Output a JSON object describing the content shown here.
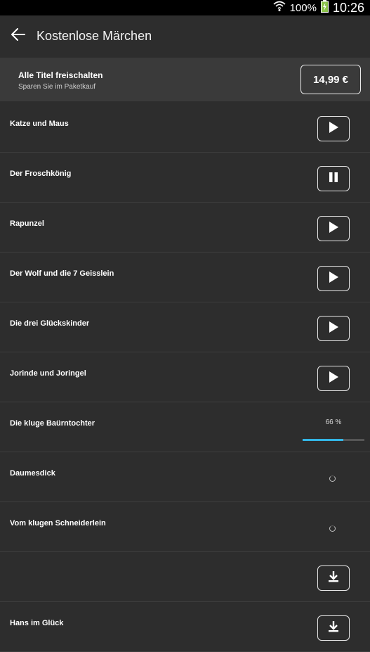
{
  "status_bar": {
    "battery_percent": "100%",
    "time": "10:26",
    "icons": [
      "wifi-icon",
      "battery-charging-icon"
    ]
  },
  "app_bar": {
    "title": "Kostenlose Märchen",
    "back_icon": "arrow-left-icon"
  },
  "promo": {
    "title": "Alle Titel freischalten",
    "subtitle": "Sparen Sie im Paketkauf",
    "price": "14,99 €"
  },
  "items": [
    {
      "title": "Katze und Maus",
      "state": "play",
      "icon": "play-icon"
    },
    {
      "title": "Der Froschkönig",
      "state": "pause",
      "icon": "pause-icon"
    },
    {
      "title": "Rapunzel",
      "state": "play",
      "icon": "play-icon"
    },
    {
      "title": "Der Wolf und die 7 Geisslein",
      "state": "play",
      "icon": "play-icon"
    },
    {
      "title": "Die drei Glückskinder",
      "state": "play",
      "icon": "play-icon"
    },
    {
      "title": "Jorinde und Joringel",
      "state": "play",
      "icon": "play-icon"
    },
    {
      "title": "Die kluge Baürntochter",
      "state": "downloading",
      "progress_label": "66 %",
      "progress": 0.66
    },
    {
      "title": "Daumesdick",
      "state": "loading",
      "icon": "spinner-icon"
    },
    {
      "title": "Vom klugen Schneiderlein",
      "state": "loading",
      "icon": "spinner-icon"
    },
    {
      "title": "",
      "state": "download",
      "icon": "download-icon"
    },
    {
      "title": "Hans im Glück",
      "state": "download",
      "icon": "download-icon"
    }
  ],
  "colors": {
    "background": "#2d2d2d",
    "promo_background": "#3a3a3a",
    "progress_accent": "#33b5e5"
  }
}
